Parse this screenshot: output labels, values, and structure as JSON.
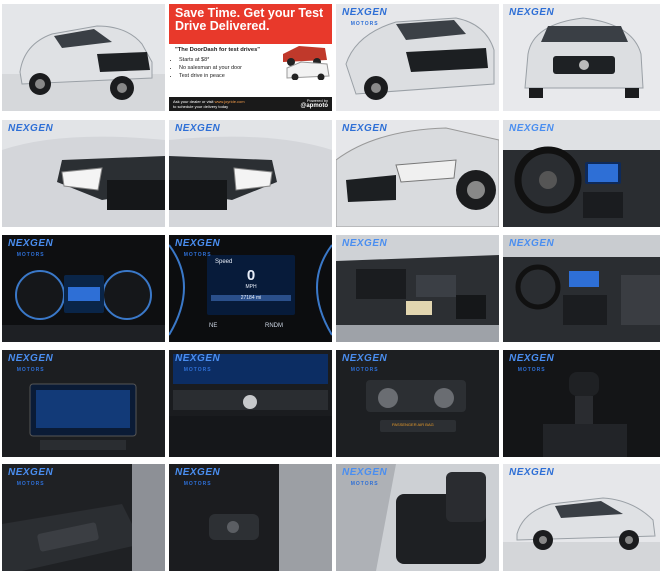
{
  "logo": {
    "brand": "NEXGEN",
    "sub": "MOTORS"
  },
  "ad": {
    "headline": "Save Time. Get your Test Drive Delivered.",
    "quote": "\"The DoorDash for test drives\"",
    "bullets": [
      "Starts at $8*",
      "No salesman at your door",
      "Test drive in peace"
    ],
    "cta_line1": "Ask your dealer or visit",
    "cta_link": "www.joyride.com",
    "cta_line2": "to schedule your delivery today",
    "powered_by": "Powered by",
    "powered_brand": "@apmoto"
  },
  "dash": {
    "speed_label": "Speed",
    "speed_value": "0",
    "speed_unit": "MPH",
    "odometer": "27184 mi",
    "heading": "NE",
    "mode": "RNDM"
  },
  "climate": {
    "warning": "PASSENGER AIR BAG"
  },
  "photos": [
    {
      "id": "exterior-front-left"
    },
    {
      "id": "ad-banner"
    },
    {
      "id": "exterior-front-left-close"
    },
    {
      "id": "exterior-front"
    },
    {
      "id": "headlight-left"
    },
    {
      "id": "headlight-right"
    },
    {
      "id": "front-quarter-close"
    },
    {
      "id": "dashboard-steering"
    },
    {
      "id": "instrument-cluster"
    },
    {
      "id": "cluster-speed-closeup"
    },
    {
      "id": "engine-bay"
    },
    {
      "id": "interior-dashboard"
    },
    {
      "id": "infotainment-screen"
    },
    {
      "id": "radio-controls"
    },
    {
      "id": "climate-controls"
    },
    {
      "id": "gear-shifter"
    },
    {
      "id": "door-panel-controls"
    },
    {
      "id": "door-mirror-controls"
    },
    {
      "id": "front-seat"
    },
    {
      "id": "exterior-side"
    }
  ]
}
